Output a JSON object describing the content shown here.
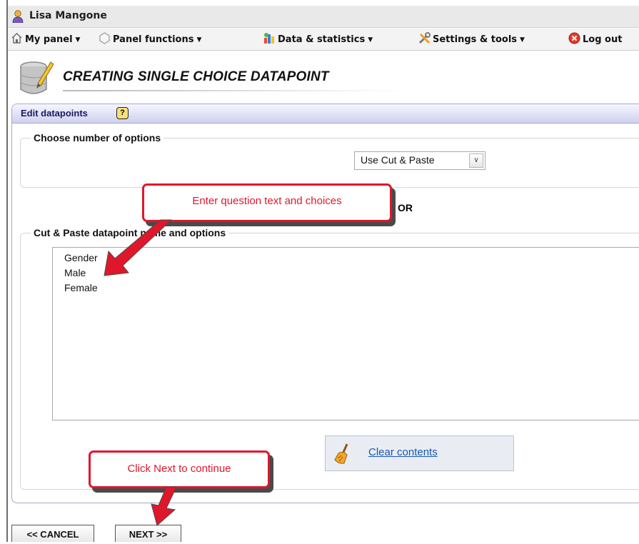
{
  "user": {
    "name": "Lisa Mangone"
  },
  "menu": [
    {
      "label": "My panel",
      "icon": "home-icon"
    },
    {
      "label": "Panel functions",
      "icon": "hexagon-icon"
    },
    {
      "label": "Data & statistics",
      "icon": "stats-icon"
    },
    {
      "label": "Settings & tools",
      "icon": "tools-icon"
    },
    {
      "label": "Log out",
      "icon": "logout-icon"
    }
  ],
  "page": {
    "title": "CREATING SINGLE CHOICE DATAPOINT",
    "icon": "database-pencil-icon"
  },
  "panel": {
    "title": "Edit datapoints",
    "help": "?"
  },
  "options_section": {
    "legend": "Choose number of options",
    "select_value": "Use Cut & Paste"
  },
  "or_label": "OR",
  "paste_section": {
    "legend": "Cut & Paste datapoint name and options",
    "lines": [
      "Gender",
      "Male",
      "Female"
    ],
    "clear_label": "Clear contents"
  },
  "buttons": {
    "cancel": "<< CANCEL",
    "next": "NEXT >>"
  },
  "callouts": {
    "enter": "Enter question text and choices",
    "next": "Click Next to continue"
  },
  "colors": {
    "callout": "#e0162b",
    "panel_header": "#cfd1ee",
    "link": "#1a56b0"
  }
}
